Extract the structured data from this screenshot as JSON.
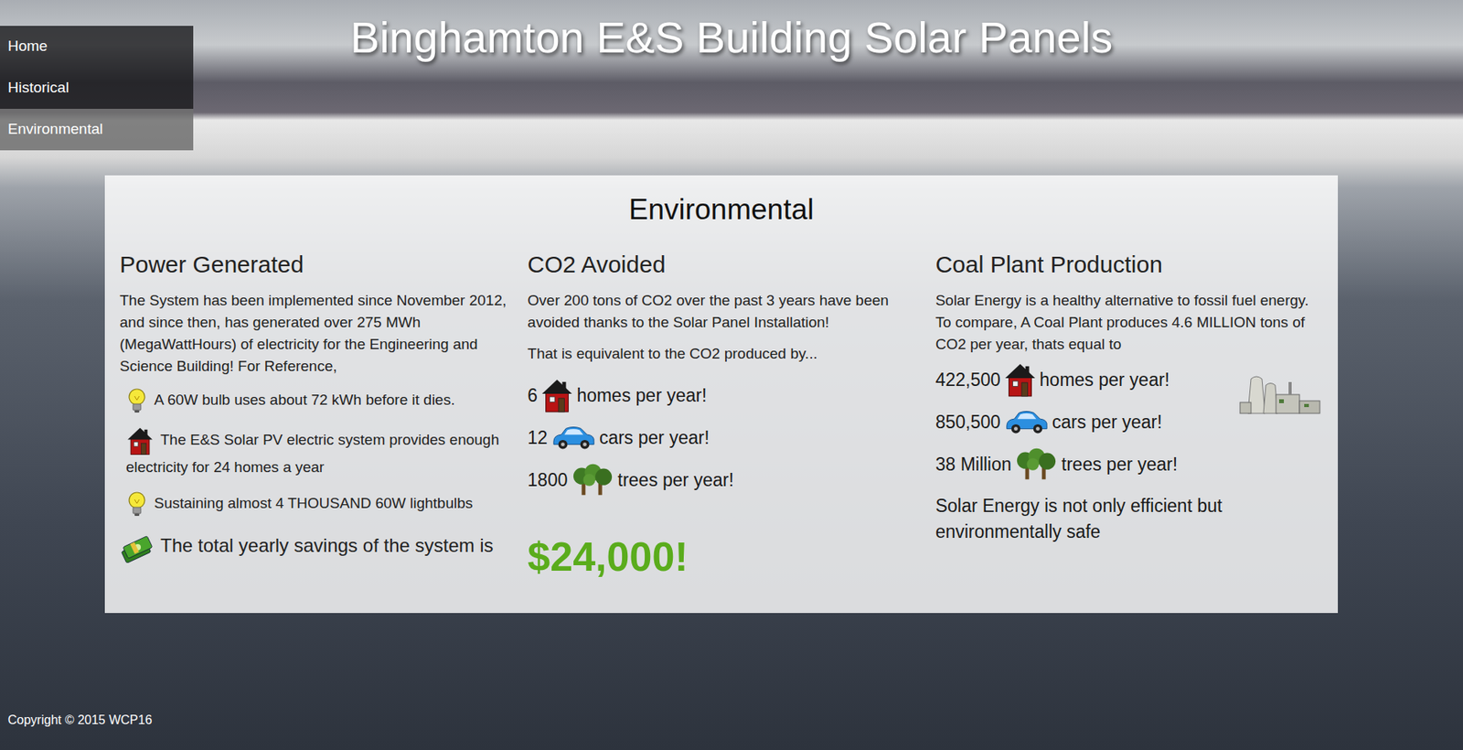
{
  "page": {
    "title": "Binghamton E&S Building Solar Panels"
  },
  "nav": {
    "items": [
      {
        "label": "Home",
        "selected": false
      },
      {
        "label": "Historical",
        "selected": false
      },
      {
        "label": "Environmental",
        "selected": true
      }
    ]
  },
  "panel": {
    "heading": "Environmental",
    "power": {
      "heading": "Power Generated",
      "intro": "The System has been implemented since November 2012, and since then, has generated over 275 MWh (MegaWattHours) of electricity for the Engineering and Science Building! For Reference,",
      "items": [
        {
          "kind": "bulb",
          "text": "A 60W bulb uses about 72 kWh before it dies."
        },
        {
          "kind": "house",
          "text": "The E&S Solar PV electric system provides enough electricity for 24 homes a year"
        },
        {
          "kind": "bulb",
          "text": "Sustaining almost 4 THOUSAND 60W lightbulbs"
        },
        {
          "kind": "money",
          "text": "The total yearly savings of the system is"
        }
      ]
    },
    "co2": {
      "heading": "CO2 Avoided",
      "paragraphs": [
        "Over 200 tons of CO2 over the past 3 years have been avoided thanks to the Solar Panel Installation!",
        "That is equivalent to the CO2 produced by..."
      ],
      "stats": [
        {
          "count": "6",
          "kind": "house",
          "label": "homes per year!"
        },
        {
          "count": "12",
          "kind": "car",
          "label": "cars per year!"
        },
        {
          "count": "1800",
          "kind": "tree",
          "label": "trees per year!"
        }
      ],
      "savings": "$24,000!"
    },
    "coal": {
      "heading": "Coal Plant Production",
      "intro": "Solar Energy is a healthy alternative to fossil fuel energy. To compare, A Coal Plant produces 4.6 MILLION tons of CO2 per year, thats equal to",
      "stats": [
        {
          "count": "422,500",
          "kind": "house",
          "label": "homes per year!"
        },
        {
          "count": "850,500",
          "kind": "car",
          "label": "cars per year!"
        },
        {
          "count": "38 Million",
          "kind": "tree",
          "label": "trees per year!"
        }
      ],
      "closing": "Solar Energy is not only efficient but environmentally safe"
    }
  },
  "footer": {
    "text": "Copyright © 2015 WCP16"
  }
}
